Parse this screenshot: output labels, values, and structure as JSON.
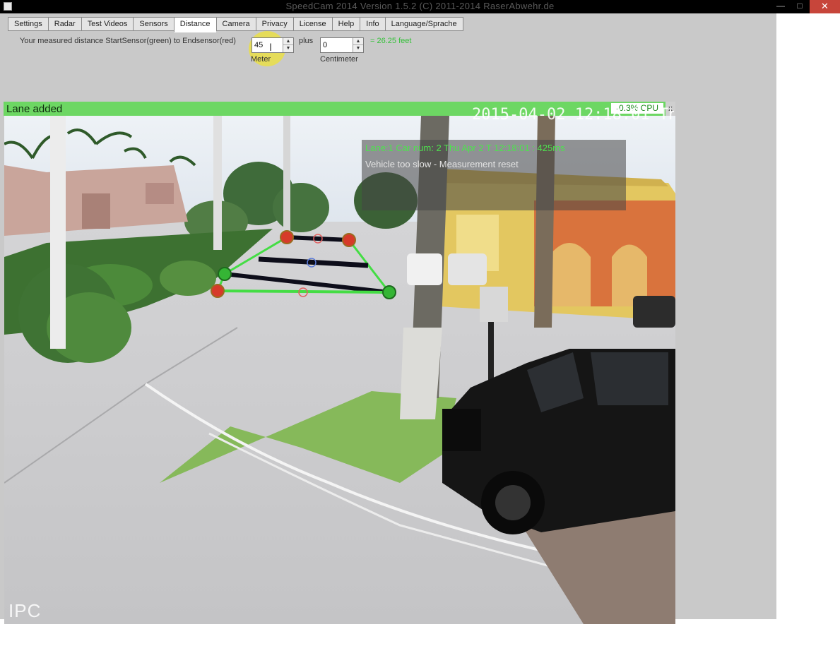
{
  "window": {
    "title": "SpeedCam 2014 Version 1.5.2 (C) 2011-2014 RaserAbwehr.de",
    "min_glyph": "—",
    "max_glyph": "□",
    "close_glyph": "✕"
  },
  "tabs": [
    {
      "label": "Settings"
    },
    {
      "label": "Radar"
    },
    {
      "label": "Test Videos"
    },
    {
      "label": "Sensors"
    },
    {
      "label": "Distance",
      "active": true
    },
    {
      "label": "Camera"
    },
    {
      "label": "Privacy"
    },
    {
      "label": "License"
    },
    {
      "label": "Help"
    },
    {
      "label": "Info"
    },
    {
      "label": "Language/Sprache"
    }
  ],
  "distance": {
    "label": "Your measured distance StartSensor(green) to Endsensor(red)",
    "meter_value": "45",
    "meter_caption": "Meter",
    "plus_label": "plus",
    "centimeter_value": "0",
    "centimeter_caption": "Centimeter",
    "feet_result": "= 26.25 feet"
  },
  "status": {
    "lane_message": "Lane added",
    "cpu": "-0.3% CPU",
    "close_label": "x"
  },
  "video": {
    "overlay_line1": "Lane:1 Car num: 2 Thu Apr 2  T 12:18:01 : 425ms",
    "overlay_line2": "Vehicle too slow - Measurement reset",
    "camera_timestamp": "2015-04-02 12:18:01 Thu",
    "camera_brand": "IPC"
  },
  "colors": {
    "status_green": "#6dd763",
    "start_sensor": "#35b535",
    "end_sensor": "#d63a2a",
    "overlay_text": "#4ee24e"
  }
}
